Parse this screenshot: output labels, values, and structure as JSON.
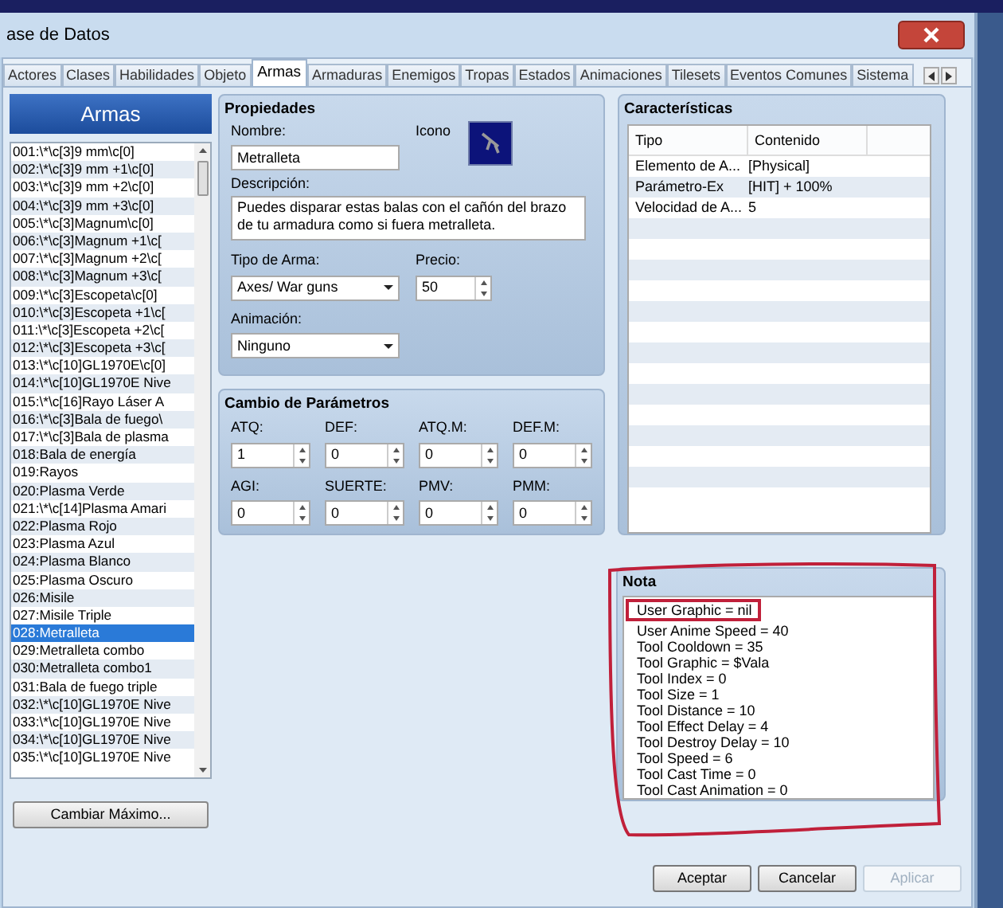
{
  "window": {
    "title": "ase de Datos"
  },
  "tabs": [
    {
      "label": "Actores",
      "selected": false
    },
    {
      "label": "Clases",
      "selected": false
    },
    {
      "label": "Habilidades",
      "selected": false
    },
    {
      "label": "Objeto",
      "selected": false
    },
    {
      "label": "Armas",
      "selected": true
    },
    {
      "label": "Armaduras",
      "selected": false
    },
    {
      "label": "Enemigos",
      "selected": false
    },
    {
      "label": "Tropas",
      "selected": false
    },
    {
      "label": "Estados",
      "selected": false
    },
    {
      "label": "Animaciones",
      "selected": false
    },
    {
      "label": "Tilesets",
      "selected": false
    },
    {
      "label": "Eventos Comunes",
      "selected": false
    },
    {
      "label": "Sistema",
      "selected": false
    }
  ],
  "list": {
    "title": "Armas",
    "items": [
      {
        "label": "001:\\*\\c[3]9 mm\\c[0]",
        "selected": false
      },
      {
        "label": "002:\\*\\c[3]9 mm +1\\c[0]",
        "selected": false
      },
      {
        "label": "003:\\*\\c[3]9 mm +2\\c[0]",
        "selected": false
      },
      {
        "label": "004:\\*\\c[3]9 mm +3\\c[0]",
        "selected": false
      },
      {
        "label": "005:\\*\\c[3]Magnum\\c[0]",
        "selected": false
      },
      {
        "label": "006:\\*\\c[3]Magnum +1\\c[",
        "selected": false
      },
      {
        "label": "007:\\*\\c[3]Magnum +2\\c[",
        "selected": false
      },
      {
        "label": "008:\\*\\c[3]Magnum +3\\c[",
        "selected": false
      },
      {
        "label": "009:\\*\\c[3]Escopeta\\c[0]",
        "selected": false
      },
      {
        "label": "010:\\*\\c[3]Escopeta +1\\c[",
        "selected": false
      },
      {
        "label": "011:\\*\\c[3]Escopeta +2\\c[",
        "selected": false
      },
      {
        "label": "012:\\*\\c[3]Escopeta +3\\c[",
        "selected": false
      },
      {
        "label": "013:\\*\\c[10]GL1970E\\c[0]",
        "selected": false
      },
      {
        "label": "014:\\*\\c[10]GL1970E Nive",
        "selected": false
      },
      {
        "label": "015:\\*\\c[16]Rayo Láser A",
        "selected": false
      },
      {
        "label": "016:\\*\\c[3]Bala de fuego\\",
        "selected": false
      },
      {
        "label": "017:\\*\\c[3]Bala de plasma",
        "selected": false
      },
      {
        "label": "018:Bala de energía",
        "selected": false
      },
      {
        "label": "019:Rayos",
        "selected": false
      },
      {
        "label": "020:Plasma Verde",
        "selected": false
      },
      {
        "label": "021:\\*\\c[14]Plasma Amari",
        "selected": false
      },
      {
        "label": "022:Plasma Rojo",
        "selected": false
      },
      {
        "label": "023:Plasma Azul",
        "selected": false
      },
      {
        "label": "024:Plasma Blanco",
        "selected": false
      },
      {
        "label": "025:Plasma Oscuro",
        "selected": false
      },
      {
        "label": "026:Misile",
        "selected": false
      },
      {
        "label": "027:Misile Triple",
        "selected": false
      },
      {
        "label": "028:Metralleta",
        "selected": true
      },
      {
        "label": "029:Metralleta combo",
        "selected": false
      },
      {
        "label": "030:Metralleta combo1",
        "selected": false
      },
      {
        "label": "031:Bala de fuego triple",
        "selected": false
      },
      {
        "label": "032:\\*\\c[10]GL1970E Nive",
        "selected": false
      },
      {
        "label": "033:\\*\\c[10]GL1970E Nive",
        "selected": false
      },
      {
        "label": "034:\\*\\c[10]GL1970E Nive",
        "selected": false
      },
      {
        "label": "035:\\*\\c[10]GL1970E Nive",
        "selected": false
      }
    ],
    "button": "Cambiar Máximo..."
  },
  "properties": {
    "title": "Propiedades",
    "name_label": "Nombre:",
    "name": "Metralleta",
    "icon_label": "Icono",
    "description_label": "Descripción:",
    "description": "Puedes disparar estas balas con el cañón del brazo de tu armadura como si fuera metralleta.",
    "weapon_type_label": "Tipo de Arma:",
    "weapon_type": "Axes/ War guns",
    "price_label": "Precio:",
    "price": "50",
    "animation_label": "Animación:",
    "animation": "Ninguno"
  },
  "parameters": {
    "title": "Cambio de Parámetros",
    "fields": [
      {
        "label": "ATQ:",
        "value": "1"
      },
      {
        "label": "DEF:",
        "value": "0"
      },
      {
        "label": "ATQ.M:",
        "value": "0"
      },
      {
        "label": "DEF.M:",
        "value": "0"
      },
      {
        "label": "AGI:",
        "value": "0"
      },
      {
        "label": "SUERTE:",
        "value": "0"
      },
      {
        "label": "PMV:",
        "value": "0"
      },
      {
        "label": "PMM:",
        "value": "0"
      }
    ]
  },
  "features": {
    "title": "Características",
    "columns": [
      "Tipo",
      "Contenido"
    ],
    "rows": [
      [
        "Elemento de A...",
        "[Physical]"
      ],
      [
        "Parámetro-Ex",
        "[HIT] + 100%"
      ],
      [
        "Velocidad de A...",
        "5"
      ]
    ]
  },
  "note": {
    "title": "Nota",
    "lines": [
      "User Graphic = nil",
      "User Anime Speed = 40",
      "Tool Cooldown = 35",
      "Tool Graphic = $Vala",
      "Tool Index = 0",
      "Tool Size = 1",
      "Tool Distance = 10",
      "Tool Effect Delay = 4",
      "Tool Destroy Delay = 10",
      "Tool Speed = 6",
      "Tool Cast Time = 0",
      "Tool Cast Animation = 0"
    ]
  },
  "buttons": [
    {
      "label": "Aceptar",
      "disabled": false
    },
    {
      "label": "Cancelar",
      "disabled": false
    },
    {
      "label": "Aplicar",
      "disabled": true
    }
  ]
}
